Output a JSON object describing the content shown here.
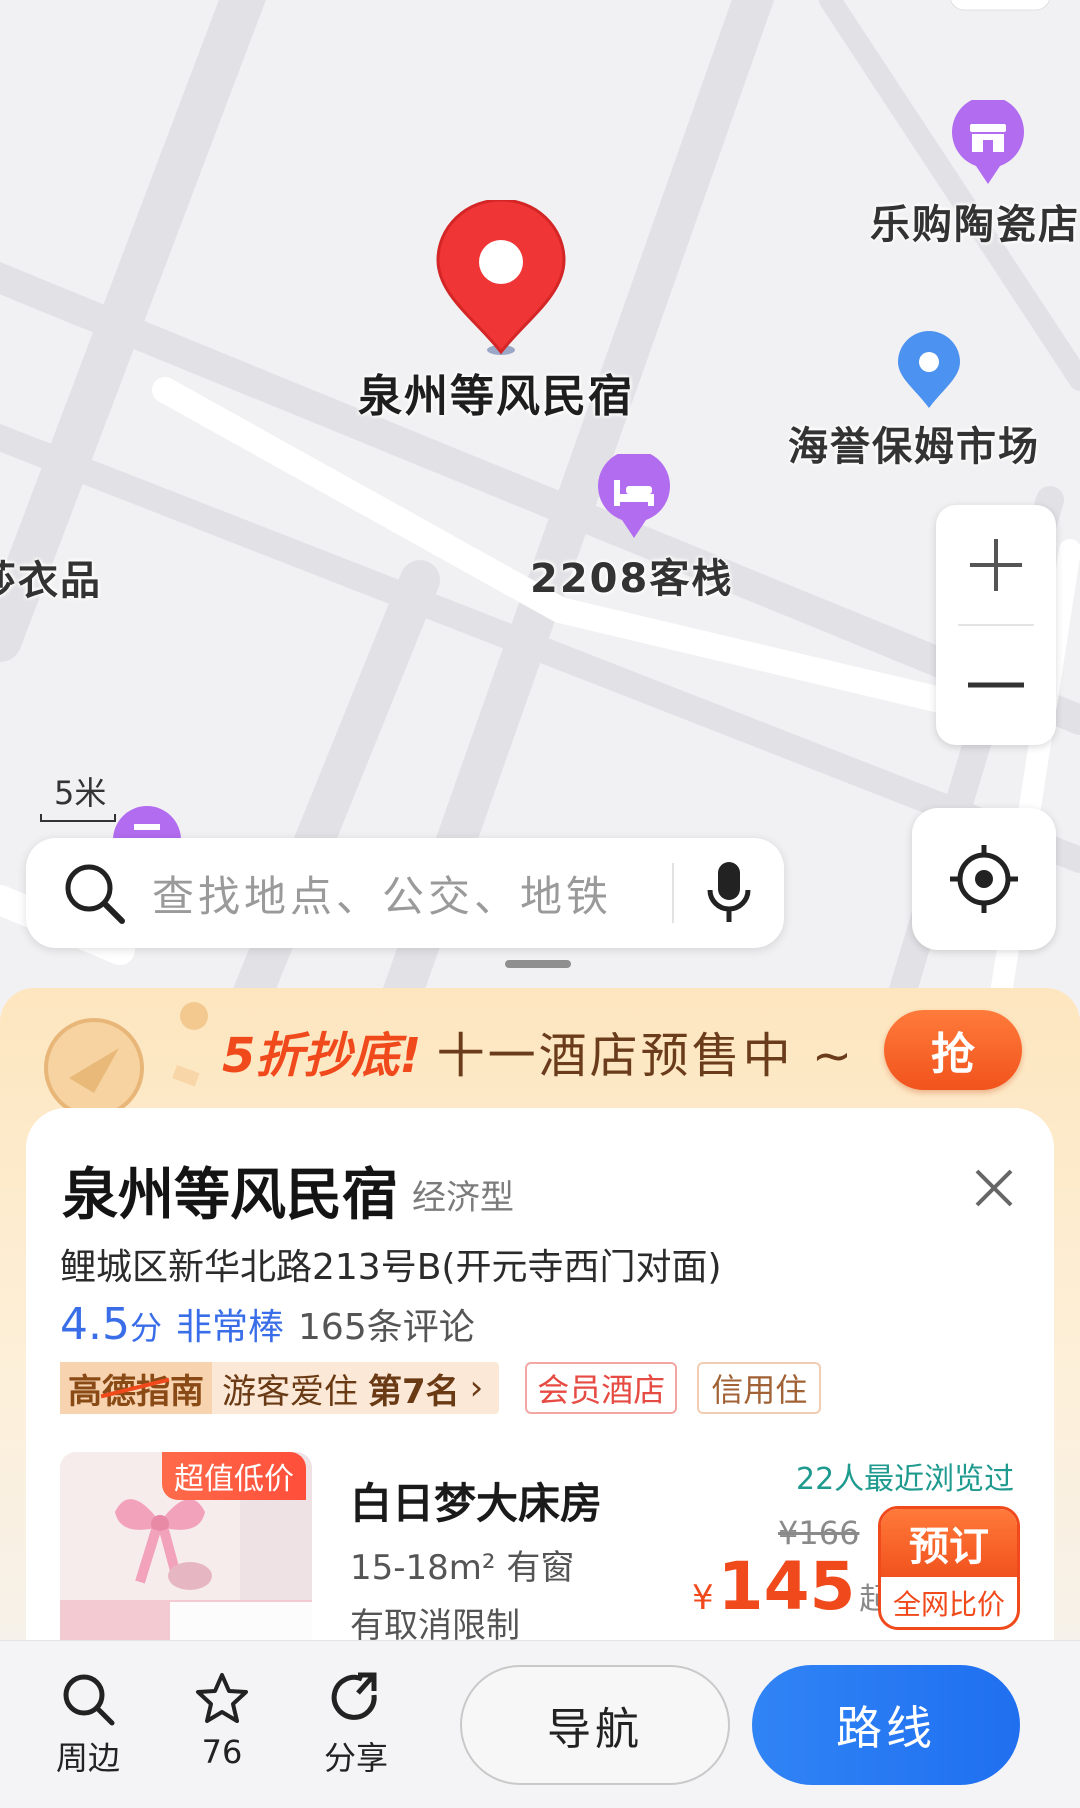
{
  "map": {
    "selected_place": "泉州等风民宿",
    "pois": [
      {
        "name": "乐购陶瓷店",
        "type": "shop"
      },
      {
        "name": "海誉保姆市场",
        "type": "place"
      },
      {
        "name": "2208客栈",
        "type": "hotel"
      },
      {
        "name": "莎衣品",
        "type": "shop"
      }
    ],
    "scale_label": "5米",
    "colors": {
      "selected_pin": "#f03a3a",
      "poi_purple": "#b26cf0",
      "poi_blue": "#4c92f0"
    }
  },
  "search": {
    "placeholder": "查找地点、公交、地铁"
  },
  "promo": {
    "highlight": "5折抄底!",
    "text": "十一酒店预售中 ~",
    "button": "抢"
  },
  "hotel": {
    "name": "泉州等风民宿",
    "type": "经济型",
    "address": "鲤城区新华北路213号B(开元寺西门对面)",
    "rating": "4.5",
    "rating_unit": "分",
    "rating_text": "非常棒",
    "reviews": "165条评论",
    "guide_logo": "高德指南",
    "guide_text": "游客爱住",
    "guide_rank": "第7名",
    "tags": [
      "会员酒店",
      "信用住"
    ]
  },
  "room": {
    "badge": "超值低价",
    "name": "白日梦大床房",
    "size": "15-18m² 有窗",
    "policy": "有取消限制",
    "viewed": "22人最近浏览过",
    "original_price": "¥166",
    "currency": "¥",
    "price": "145",
    "price_suffix": "起",
    "book_label": "预订",
    "compare_label": "全网比价"
  },
  "bottom": {
    "nearby": "周边",
    "favorites": "76",
    "share": "分享",
    "navigate": "导航",
    "route": "路线"
  }
}
